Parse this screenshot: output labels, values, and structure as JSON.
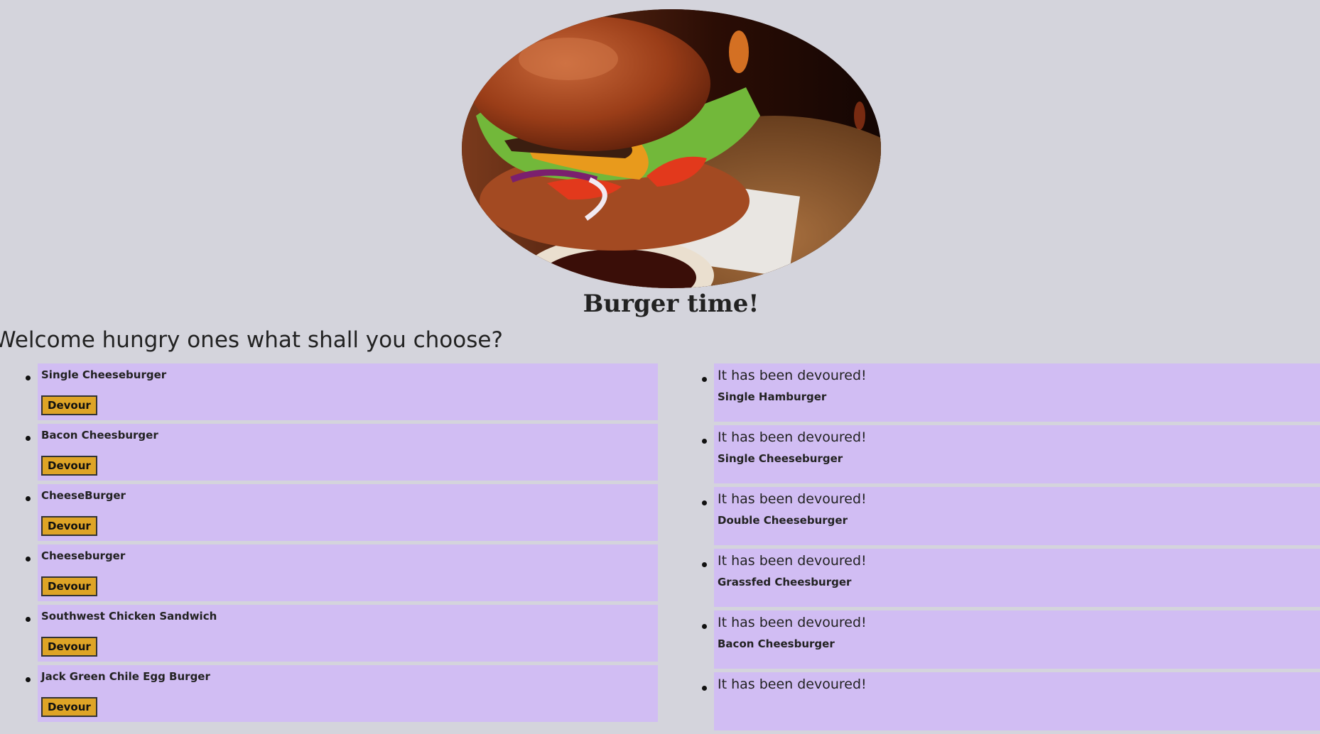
{
  "hero": {
    "image": "burger-photo"
  },
  "title": "Burger time!",
  "welcome": "Welcome hungry ones what shall you choose?",
  "available": [
    {
      "name": "Single Cheeseburger",
      "button": "Devour"
    },
    {
      "name": "Bacon Cheesburger",
      "button": "Devour"
    },
    {
      "name": "CheeseBurger",
      "button": "Devour"
    },
    {
      "name": "Cheeseburger",
      "button": "Devour"
    },
    {
      "name": "Southwest Chicken Sandwich",
      "button": "Devour"
    },
    {
      "name": "Jack Green Chile Egg Burger",
      "button": "Devour"
    }
  ],
  "devoured": [
    {
      "message": "It has been devoured!",
      "name": "Single Hamburger"
    },
    {
      "message": "It has been devoured!",
      "name": "Single Cheeseburger"
    },
    {
      "message": "It has been devoured!",
      "name": "Double Cheeseburger"
    },
    {
      "message": "It has been devoured!",
      "name": "Grassfed Cheesburger"
    },
    {
      "message": "It has been devoured!",
      "name": "Bacon Cheesburger"
    },
    {
      "message": "It has been devoured!",
      "name": ""
    }
  ],
  "colors": {
    "background": "#d4d4dc",
    "card": "#d1bdf3",
    "button": "#dea426"
  }
}
